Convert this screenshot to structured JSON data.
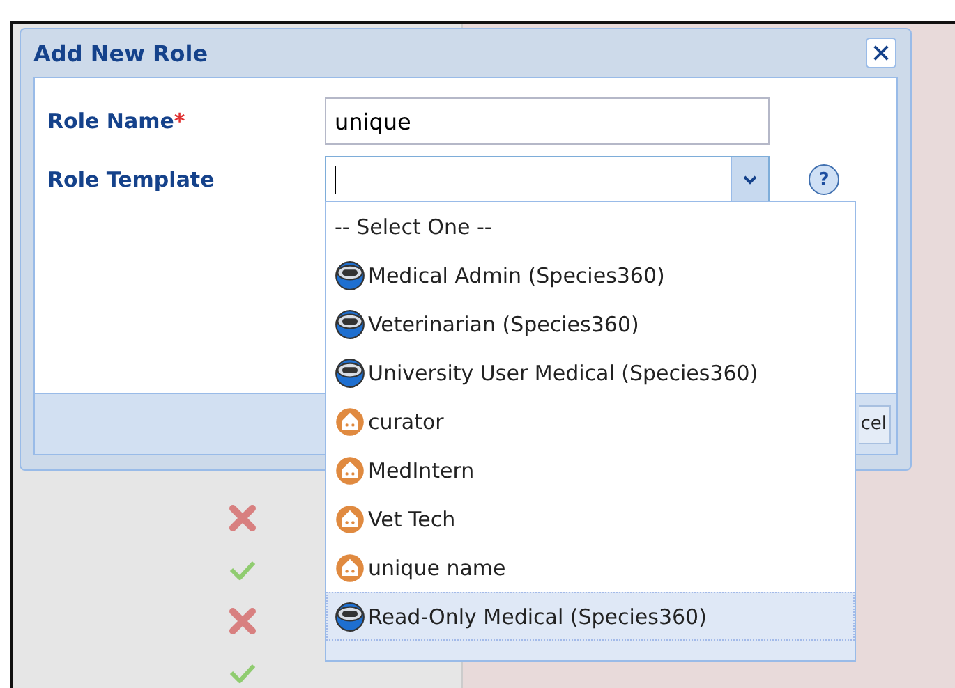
{
  "background": {
    "status_icons": [
      {
        "kind": "cross"
      },
      {
        "kind": "check"
      },
      {
        "kind": "cross"
      },
      {
        "kind": "check"
      }
    ]
  },
  "dialog": {
    "title": "Add New Role",
    "fields": [
      {
        "label": "Role Name",
        "required": "*",
        "value": "unique"
      },
      {
        "label": "Role Template",
        "help": "?"
      }
    ],
    "footer_button": "cel",
    "dropdown": {
      "items": [
        {
          "kind": "none",
          "label": "-- Select One --",
          "selected": false
        },
        {
          "kind": "species",
          "label": "Medical Admin (Species360)",
          "selected": false
        },
        {
          "kind": "species",
          "label": "Veterinarian (Species360)",
          "selected": false
        },
        {
          "kind": "species",
          "label": "University User Medical (Species360)",
          "selected": false
        },
        {
          "kind": "custom",
          "label": "curator",
          "selected": false
        },
        {
          "kind": "custom",
          "label": "MedIntern",
          "selected": false
        },
        {
          "kind": "custom",
          "label": "Vet Tech",
          "selected": false
        },
        {
          "kind": "custom",
          "label": "unique name",
          "selected": false
        },
        {
          "kind": "species",
          "label": "Read-Only Medical (Species360)",
          "selected": true
        }
      ]
    }
  }
}
